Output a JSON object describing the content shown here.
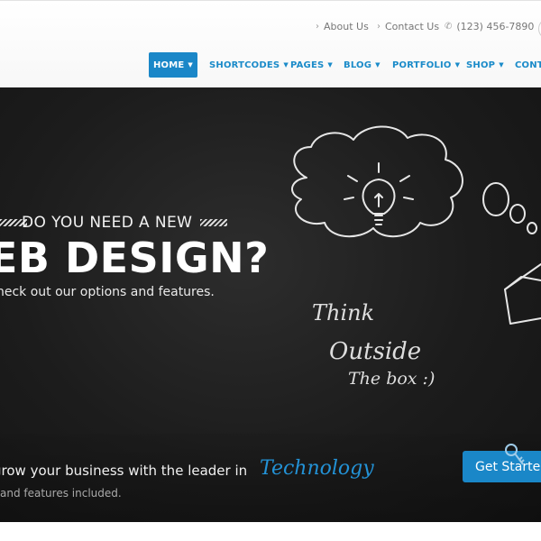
{
  "topbar": {
    "about_label": "About Us",
    "contact_label": "Contact Us",
    "phone": "(123) 456-7890",
    "icons": {
      "about": "chevron-right-icon",
      "contact": "chevron-right-icon",
      "phone": "phone-icon"
    }
  },
  "nav": {
    "home": "HOME",
    "shortcodes": "SHORTCODES",
    "pages": "PAGES",
    "blog": "BLOG",
    "portfolio": "PORTFOLIO",
    "shop": "SHOP",
    "contact": "CONTA",
    "active": "HOME",
    "caret_icon": "caret-down-icon"
  },
  "hero": {
    "title_small": "DO YOU NEED A NEW",
    "title_big": "EB DESIGN?",
    "subtitle": "heck out our options and features.",
    "chalk_think": "Think",
    "chalk_outside": "Outside",
    "chalk_box": "The box :)"
  },
  "cta": {
    "text": "grow your business with the leader in",
    "highlight": "Technology",
    "subtext": "and features included.",
    "button_label": "Get Started"
  },
  "colors": {
    "accent": "#1a87c8",
    "nav_text": "#1a8bc9",
    "hero_bg": "#1c1c1c",
    "highlight": "#2392d6"
  }
}
